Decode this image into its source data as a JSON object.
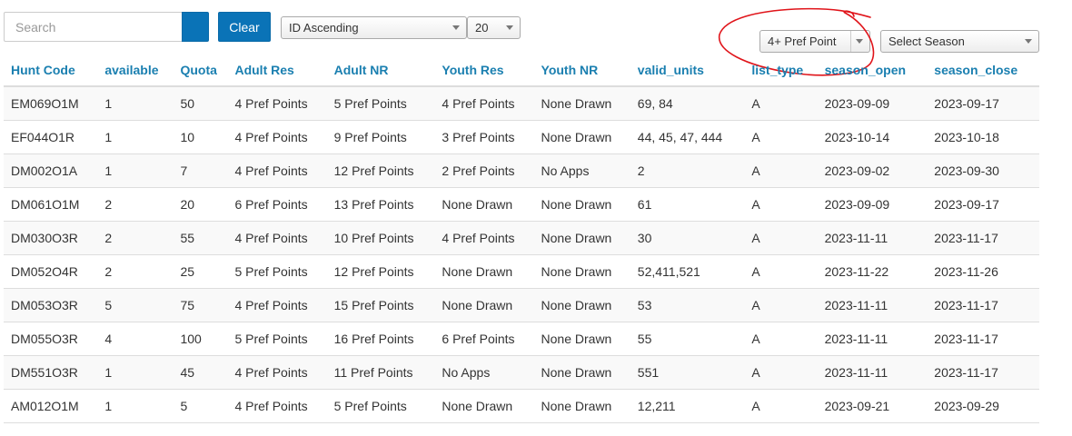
{
  "toolbar": {
    "search_placeholder": "Search",
    "clear_label": "Clear",
    "sort_value": "ID Ascending",
    "page_size_value": "20",
    "pref_points_value": "4+ Pref Point",
    "season_value": "Select Season"
  },
  "colors": {
    "accent": "#0a73b7",
    "header_text": "#1a7fb0",
    "annotation": "#e0141a"
  },
  "icons": {
    "search_button": "search-icon",
    "dropdown": "chevron-down-icon"
  },
  "table": {
    "columns": [
      "Hunt Code",
      "available",
      "Quota",
      "Adult Res",
      "Adult NR",
      "Youth Res",
      "Youth NR",
      "valid_units",
      "list_type",
      "season_open",
      "season_close"
    ],
    "rows": [
      [
        "EM069O1M",
        "1",
        "50",
        "4 Pref Points",
        "5 Pref Points",
        "4 Pref Points",
        "None Drawn",
        "69, 84",
        "A",
        "2023-09-09",
        "2023-09-17"
      ],
      [
        "EF044O1R",
        "1",
        "10",
        "4 Pref Points",
        "9 Pref Points",
        "3 Pref Points",
        "None Drawn",
        "44, 45, 47, 444",
        "A",
        "2023-10-14",
        "2023-10-18"
      ],
      [
        "DM002O1A",
        "1",
        "7",
        "4 Pref Points",
        "12 Pref Points",
        "2 Pref Points",
        "No Apps",
        "2",
        "A",
        "2023-09-02",
        "2023-09-30"
      ],
      [
        "DM061O1M",
        "2",
        "20",
        "6 Pref Points",
        "13 Pref Points",
        "None Drawn",
        "None Drawn",
        "61",
        "A",
        "2023-09-09",
        "2023-09-17"
      ],
      [
        "DM030O3R",
        "2",
        "55",
        "4 Pref Points",
        "10 Pref Points",
        "4 Pref Points",
        "None Drawn",
        "30",
        "A",
        "2023-11-11",
        "2023-11-17"
      ],
      [
        "DM052O4R",
        "2",
        "25",
        "5 Pref Points",
        "12 Pref Points",
        "None Drawn",
        "None Drawn",
        "52,411,521",
        "A",
        "2023-11-22",
        "2023-11-26"
      ],
      [
        "DM053O3R",
        "5",
        "75",
        "4 Pref Points",
        "15 Pref Points",
        "None Drawn",
        "None Drawn",
        "53",
        "A",
        "2023-11-11",
        "2023-11-17"
      ],
      [
        "DM055O3R",
        "4",
        "100",
        "5 Pref Points",
        "16 Pref Points",
        "6 Pref Points",
        "None Drawn",
        "55",
        "A",
        "2023-11-11",
        "2023-11-17"
      ],
      [
        "DM551O3R",
        "1",
        "45",
        "4 Pref Points",
        "11 Pref Points",
        "No Apps",
        "None Drawn",
        "551",
        "A",
        "2023-11-11",
        "2023-11-17"
      ],
      [
        "AM012O1M",
        "1",
        "5",
        "4 Pref Points",
        "5 Pref Points",
        "None Drawn",
        "None Drawn",
        "12,211",
        "A",
        "2023-09-21",
        "2023-09-29"
      ]
    ]
  }
}
